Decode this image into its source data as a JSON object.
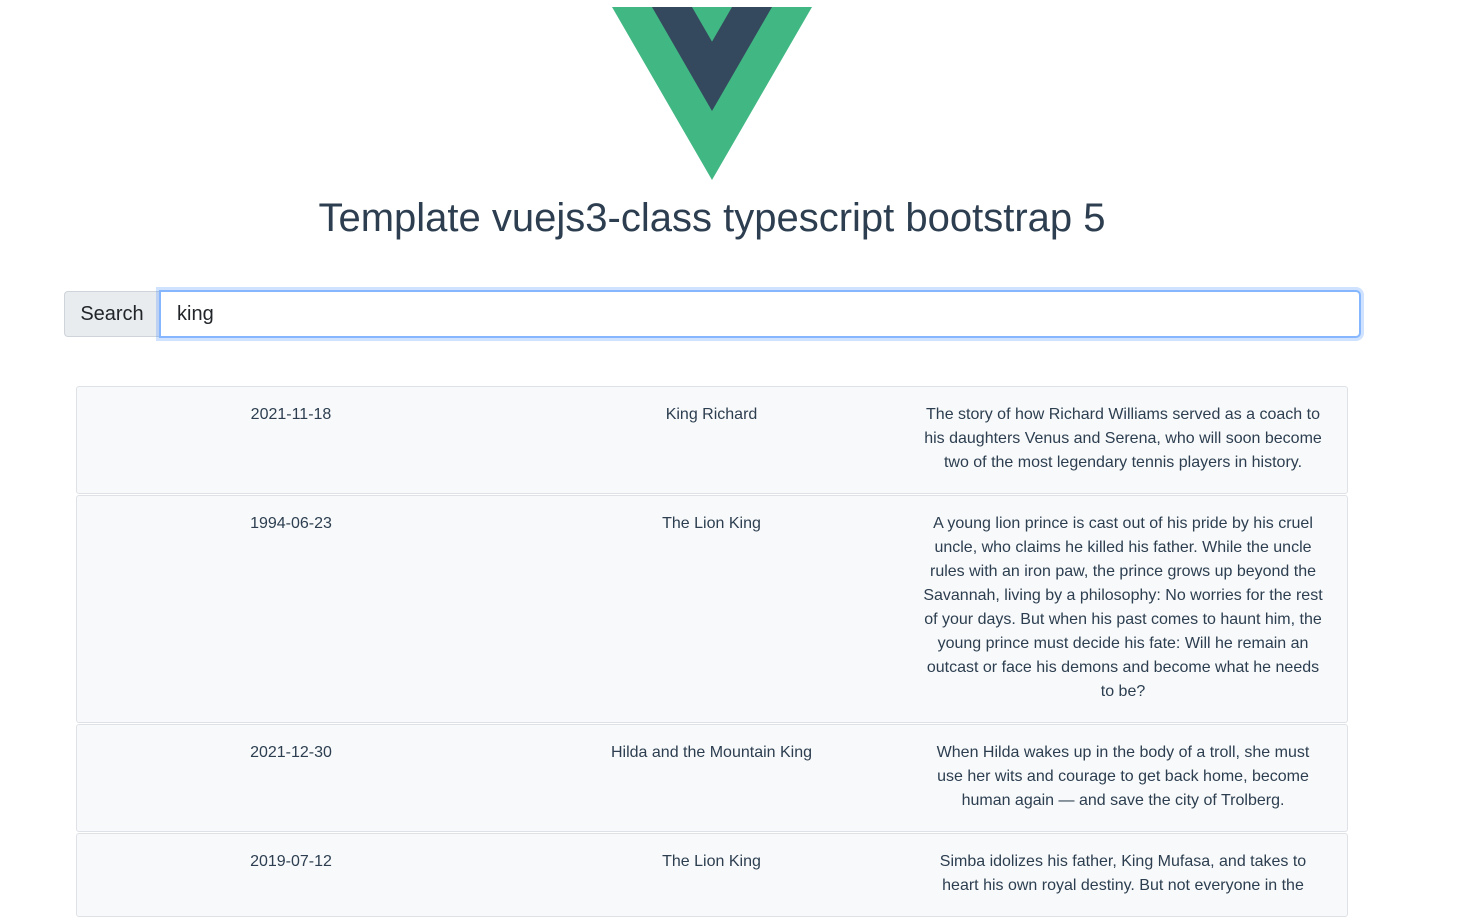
{
  "header": {
    "title": "Template vuejs3-class typescript bootstrap 5",
    "logo": "vue-logo"
  },
  "colors": {
    "vue_green": "#41b883",
    "vue_dark": "#35495e",
    "focus_border": "#86b7fe"
  },
  "search": {
    "label": "Search",
    "value": "king",
    "placeholder": ""
  },
  "movies": [
    {
      "date": "2021-11-18",
      "title": "King Richard",
      "description": "The story of how Richard Williams served as a coach to his daughters Venus and Serena, who will soon become two of the most legendary tennis players in history."
    },
    {
      "date": "1994-06-23",
      "title": "The Lion King",
      "description": "A young lion prince is cast out of his pride by his cruel uncle, who claims he killed his father. While the uncle rules with an iron paw, the prince grows up beyond the Savannah, living by a philosophy: No worries for the rest of your days. But when his past comes to haunt him, the young prince must decide his fate: Will he remain an outcast or face his demons and become what he needs to be?"
    },
    {
      "date": "2021-12-30",
      "title": "Hilda and the Mountain King",
      "description": "When Hilda wakes up in the body of a troll, she must use her wits and courage to get back home, become human again — and save the city of Trolberg."
    },
    {
      "date": "2019-07-12",
      "title": "The Lion King",
      "description": "Simba idolizes his father, King Mufasa, and takes to heart his own royal destiny. But not everyone in the"
    }
  ]
}
